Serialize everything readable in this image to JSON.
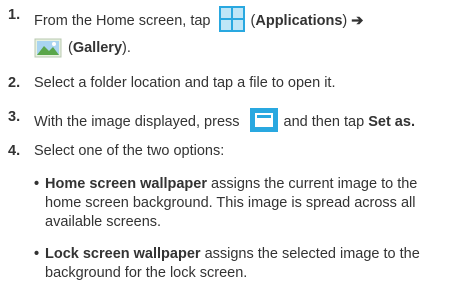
{
  "steps": [
    {
      "number": "1.",
      "text_before": "From the Home screen, tap",
      "icon1": "applications-icon",
      "label1": "(Applications)",
      "arrow": " ➔",
      "icon2": "gallery-icon",
      "label2": "(Gallery)."
    },
    {
      "number": "2.",
      "text": "Select a folder location and tap a file to open it."
    },
    {
      "number": "3.",
      "text_before": "With the image displayed, press",
      "icon": "menu-key-icon",
      "text_after": "and then tap",
      "bold": "Set as."
    },
    {
      "number": "4.",
      "text": "Select one of the two options:"
    }
  ],
  "options": [
    {
      "bold": "Home screen wallpaper",
      "text": " assigns the current image to the home screen background. This image is spread across all available screens."
    },
    {
      "bold": "Lock screen wallpaper",
      "text": " assigns the selected image to the background for the lock screen."
    }
  ],
  "colors": {
    "icon_blue": "#29a8e0",
    "text": "#333333"
  }
}
